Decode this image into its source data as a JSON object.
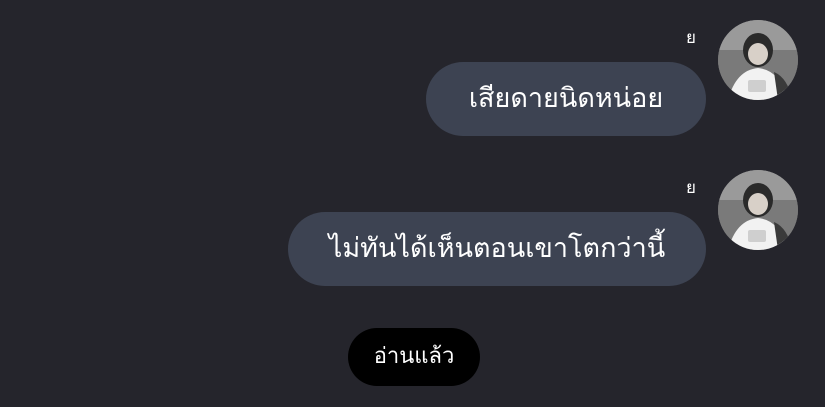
{
  "messages": [
    {
      "sender": "ย",
      "text": "เสียดายนิดหน่อย"
    },
    {
      "sender": "ย",
      "text": "ไม่ทันได้เห็นตอนเขาโตกว่านี้"
    }
  ],
  "read_receipt": "อ่านแล้ว",
  "colors": {
    "background": "#25252c",
    "bubble": "#3d4352",
    "read_badge": "#000000",
    "text": "#ffffff"
  }
}
